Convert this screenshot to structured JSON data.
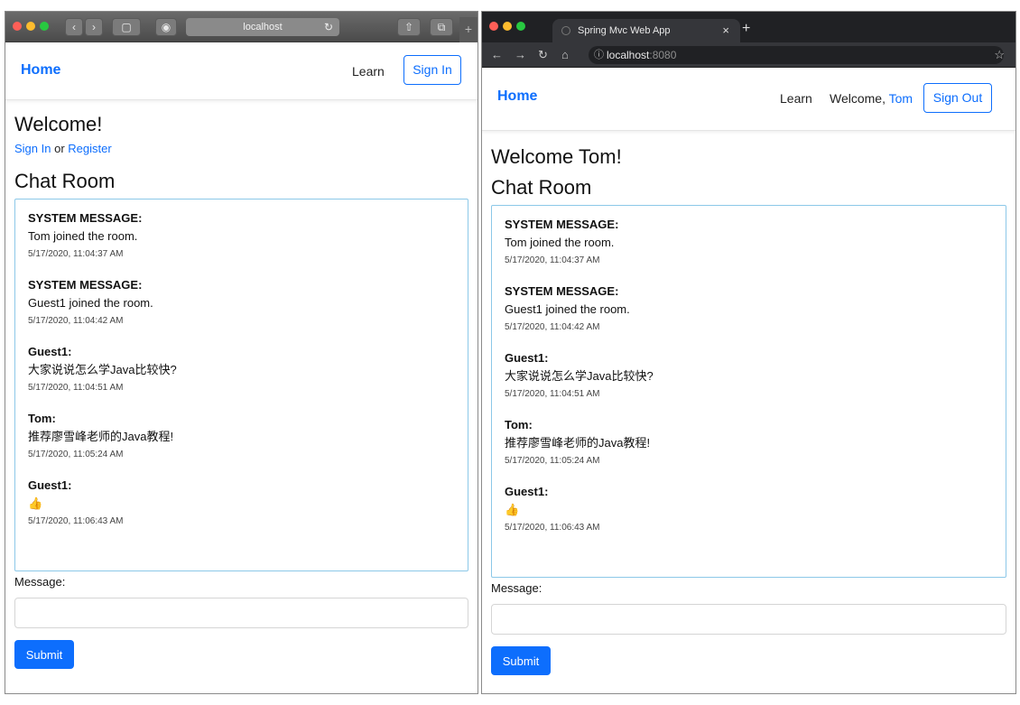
{
  "left_window": {
    "browser": {
      "address": "localhost"
    },
    "navbar": {
      "brand": "Home",
      "learn": "Learn",
      "signin_button": "Sign In"
    },
    "page": {
      "welcome_heading": "Welcome!",
      "signin_link": "Sign In",
      "or_text": "or",
      "register_link": "Register",
      "chat_heading": "Chat Room",
      "message_label": "Message:",
      "submit_button": "Submit"
    }
  },
  "right_window": {
    "browser": {
      "tab_title": "Spring Mvc Web App",
      "address_host": "localhost",
      "address_port": ":8080"
    },
    "navbar": {
      "brand": "Home",
      "learn": "Learn",
      "welcome_prefix": "Welcome,",
      "username": "Tom",
      "signout_button": "Sign Out"
    },
    "page": {
      "welcome_heading": "Welcome Tom!",
      "chat_heading": "Chat Room",
      "message_label": "Message:",
      "submit_button": "Submit"
    }
  },
  "messages": [
    {
      "sender": "SYSTEM MESSAGE:",
      "text": "Tom joined the room.",
      "time": "5/17/2020, 11:04:37 AM"
    },
    {
      "sender": "SYSTEM MESSAGE:",
      "text": "Guest1 joined the room.",
      "time": "5/17/2020, 11:04:42 AM"
    },
    {
      "sender": "Guest1:",
      "text": "大家说说怎么学Java比较快?",
      "time": "5/17/2020, 11:04:51 AM"
    },
    {
      "sender": "Tom:",
      "text": "推荐廖雪峰老师的Java教程!",
      "time": "5/17/2020, 11:05:24 AM"
    },
    {
      "sender": "Guest1:",
      "text": "👍",
      "time": "5/17/2020, 11:06:43 AM"
    }
  ],
  "icons": {
    "thumbs_up": "thumbs-up-icon",
    "back": "back-arrow-icon",
    "forward": "forward-arrow-icon",
    "reload": "reload-icon",
    "home": "home-icon",
    "star": "star-icon"
  },
  "colors": {
    "link": "#0d6efd",
    "chat_border": "#8cc8e8",
    "submit_bg": "#0d6efd"
  }
}
